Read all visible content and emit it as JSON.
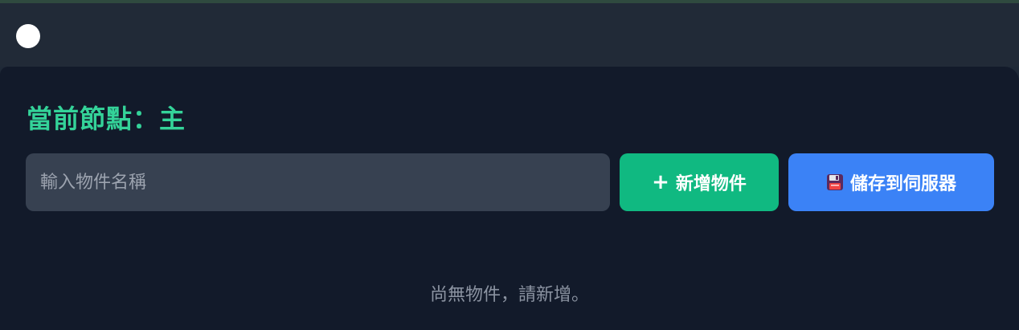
{
  "header": {
    "status_dot_color": "#ffffff"
  },
  "panel": {
    "title": "當前節點：主",
    "input": {
      "value": "",
      "placeholder": "輸入物件名稱"
    },
    "buttons": {
      "add": {
        "icon": "plus-icon",
        "label": "新增物件",
        "color": "#10b981"
      },
      "save": {
        "icon": "floppy-disk-icon",
        "label": "儲存到伺服器",
        "color": "#3b82f6"
      }
    },
    "empty_message": "尚無物件，請新增。"
  },
  "colors": {
    "title": "#34d399",
    "panel_background": "#121a2a",
    "header_background": "#212a37",
    "input_background": "#374151"
  }
}
